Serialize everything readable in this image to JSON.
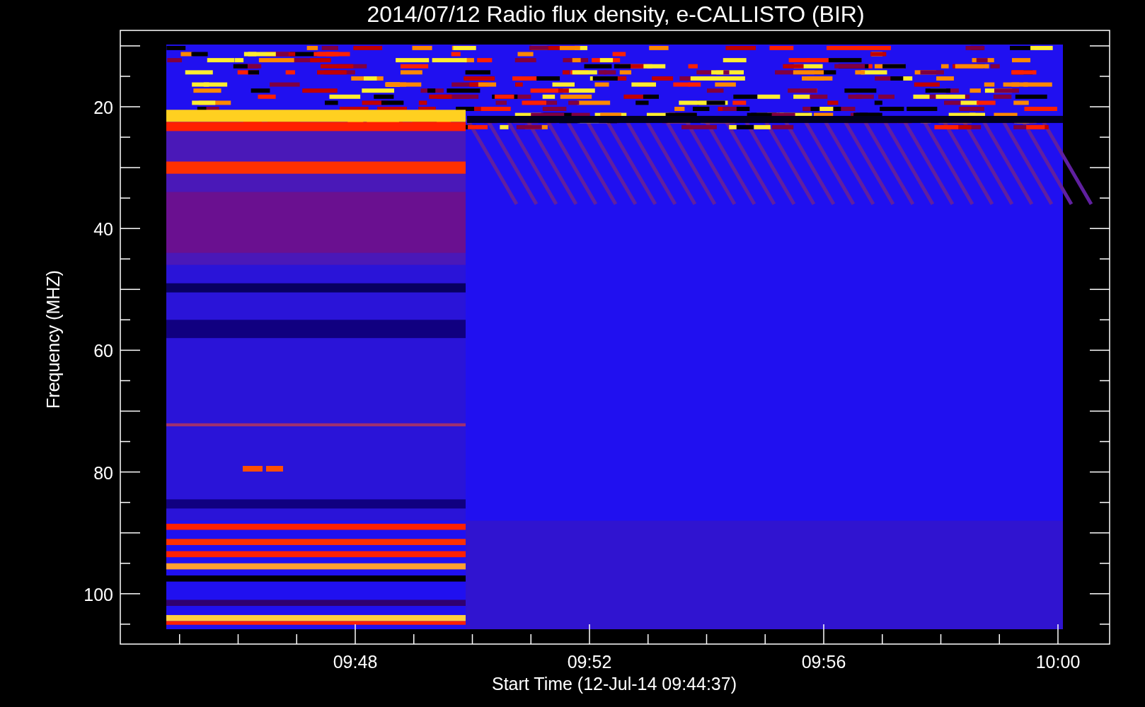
{
  "title": "2014/07/12  Radio flux density, e-CALLISTO (BIR)",
  "y_axis": {
    "label": "Frequency (MHZ)",
    "ticks": [
      "20",
      "40",
      "60",
      "80",
      "100"
    ]
  },
  "x_axis": {
    "label": "Start Time (12-Jul-14 09:44:37)",
    "ticks": [
      "09:48",
      "09:52",
      "09:56",
      "10:00"
    ]
  }
}
